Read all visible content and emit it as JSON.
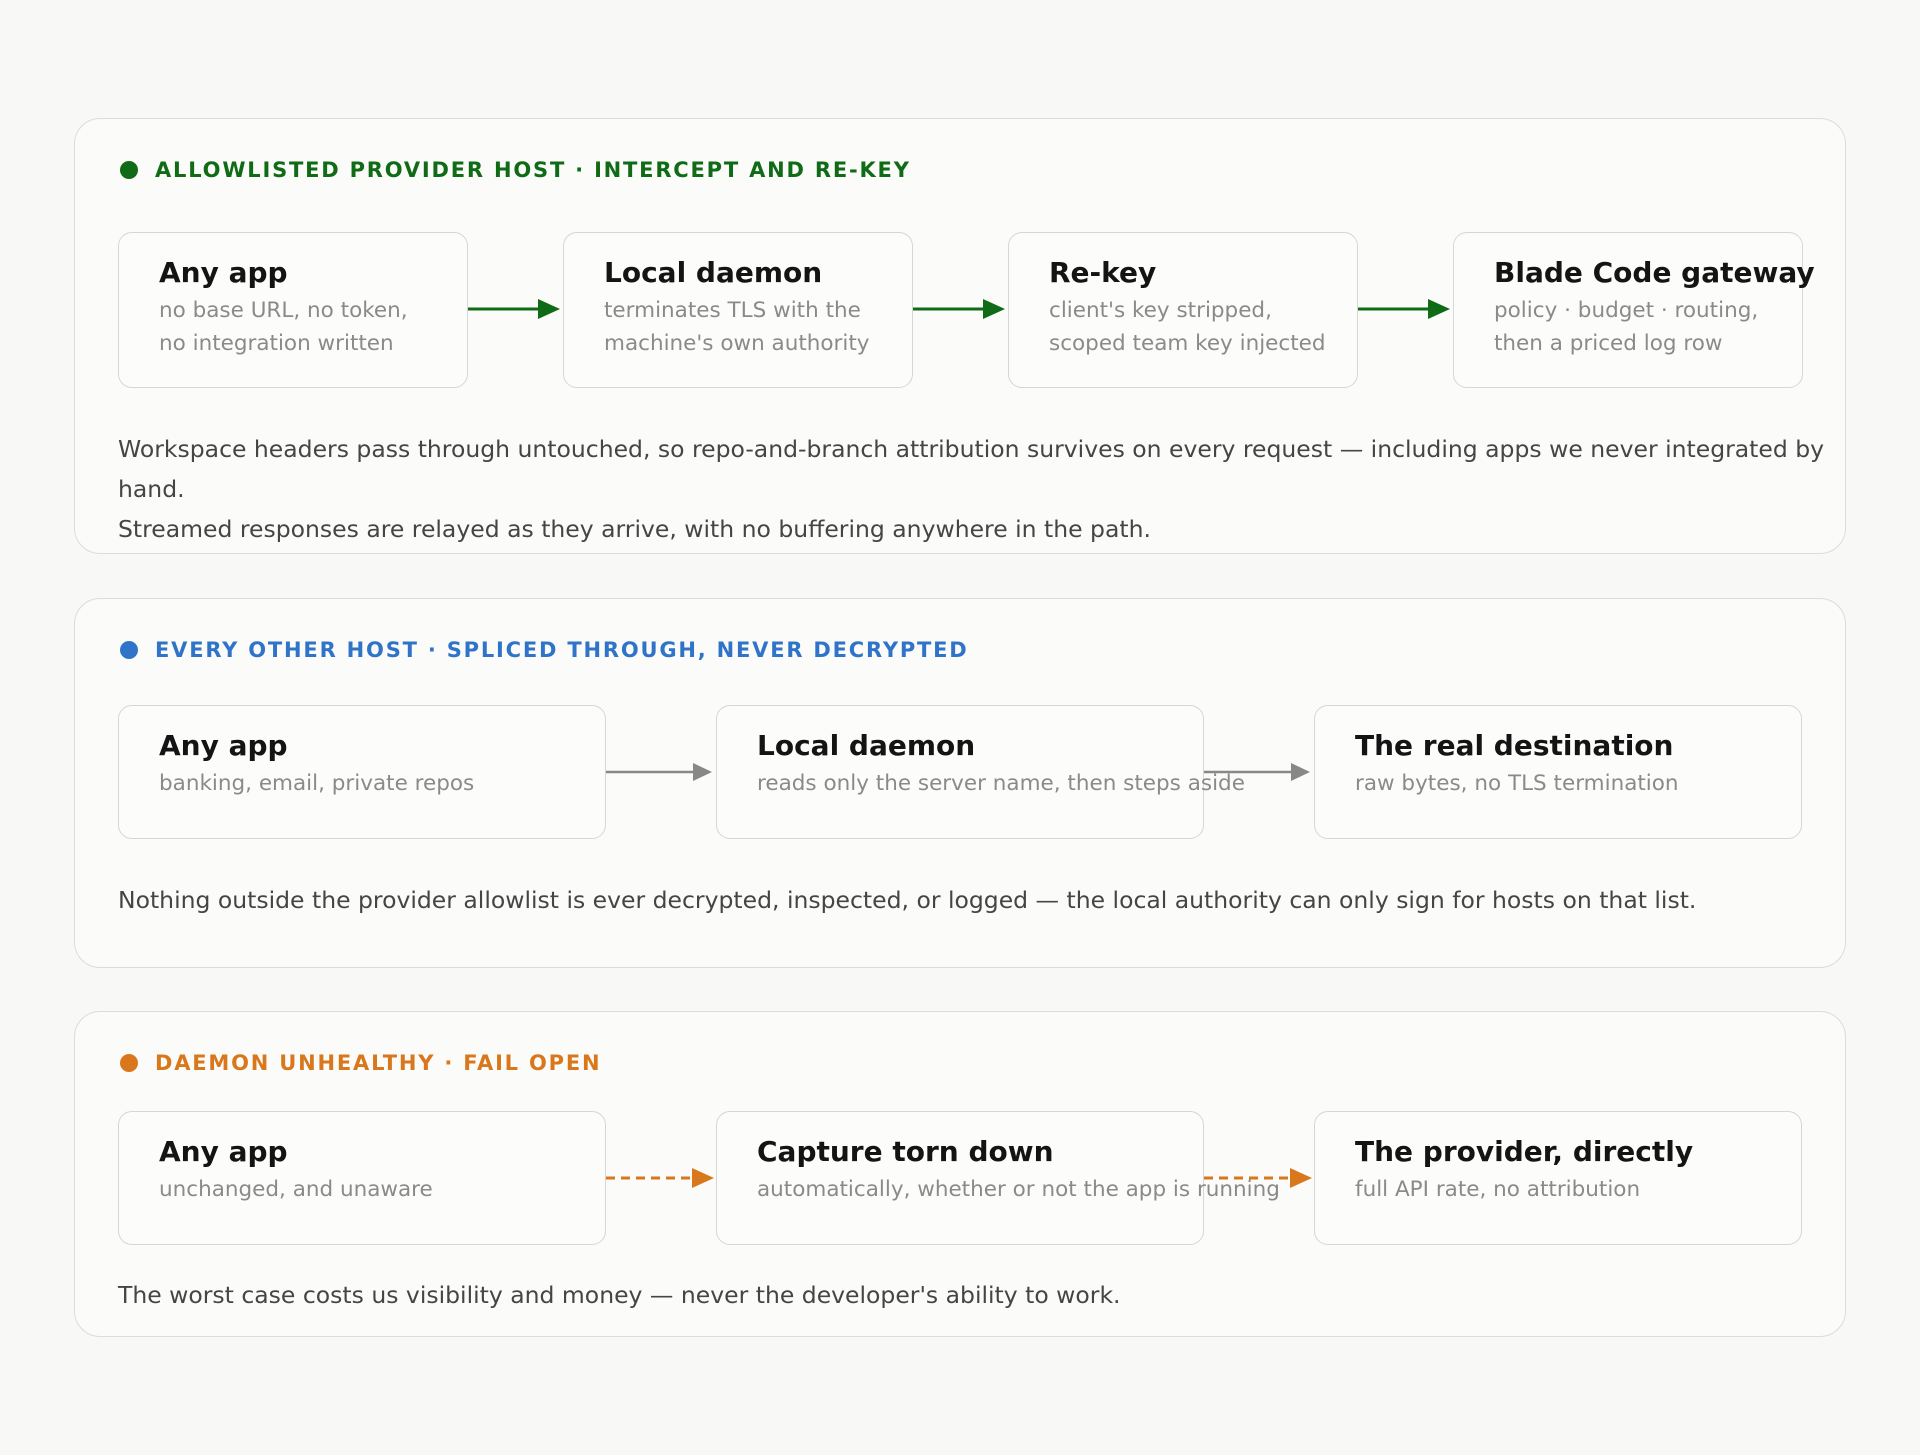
{
  "colors": {
    "green": "#0f6b16",
    "blue": "#2f74c8",
    "orange": "#d9771c",
    "gray": "#888888"
  },
  "panels": [
    {
      "title": "ALLOWLISTED PROVIDER HOST · INTERCEPT AND RE-KEY",
      "nodes": [
        {
          "title": "Any app",
          "subtitle": "no base URL, no token,\nno integration written"
        },
        {
          "title": "Local daemon",
          "subtitle": "terminates TLS with the\nmachine's own authority"
        },
        {
          "title": "Re-key",
          "subtitle": "client's key stripped,\nscoped team key injected"
        },
        {
          "title": "Blade Code gateway",
          "subtitle": "policy · budget · routing,\nthen a priced log row"
        }
      ],
      "note": "Workspace headers pass through untouched, so repo-and-branch attribution survives on every request — including apps we never integrated by hand.\nStreamed responses are relayed as they arrive, with no buffering anywhere in the path."
    },
    {
      "title": "EVERY OTHER HOST · SPLICED THROUGH, NEVER DECRYPTED",
      "nodes": [
        {
          "title": "Any app",
          "subtitle": "banking, email, private repos"
        },
        {
          "title": "Local daemon",
          "subtitle": "reads only the server name, then steps aside"
        },
        {
          "title": "The real destination",
          "subtitle": "raw bytes, no TLS termination"
        }
      ],
      "note": "Nothing outside the provider allowlist is ever decrypted, inspected, or logged — the local authority can only sign for hosts on that list."
    },
    {
      "title": "DAEMON UNHEALTHY · FAIL OPEN",
      "nodes": [
        {
          "title": "Any app",
          "subtitle": "unchanged, and unaware"
        },
        {
          "title": "Capture torn down",
          "subtitle": "automatically, whether or not the app is running"
        },
        {
          "title": "The provider, directly",
          "subtitle": "full API rate, no attribution"
        }
      ],
      "note": "The worst case costs us visibility and money — never the developer's ability to work."
    }
  ]
}
